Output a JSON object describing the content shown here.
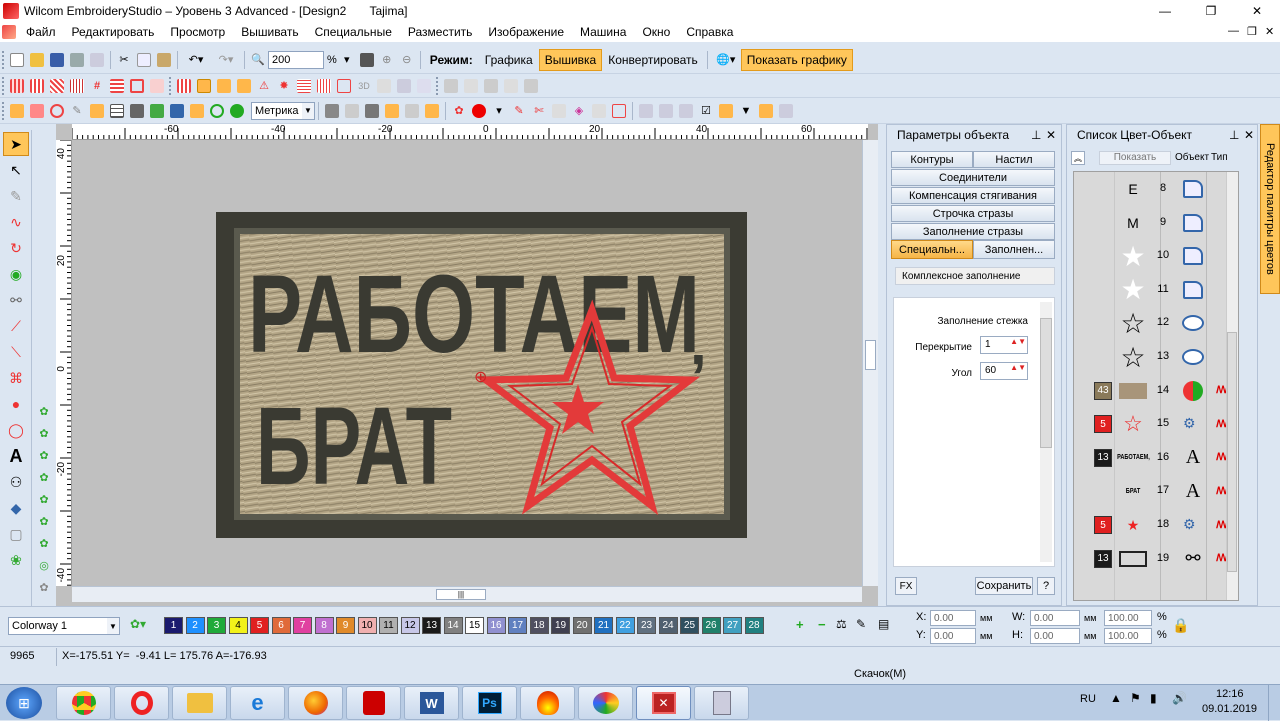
{
  "window": {
    "title": "Wilcom EmbroideryStudio – Уровень 3 Advanced - [Design2       Tajima]",
    "controls": [
      "—",
      "❐",
      "✕"
    ]
  },
  "menu": [
    "Файл",
    "Редактировать",
    "Просмотр",
    "Вышивать",
    "Специальные",
    "Разместить",
    "Изображение",
    "Машина",
    "Окно",
    "Справка"
  ],
  "toolbar1": {
    "zoom_value": "200",
    "zoom_unit": "%",
    "mode_label": "Режим:",
    "mode_graphics": "Графика",
    "mode_embroidery": "Вышивка",
    "convert": "Конвертировать",
    "show_graphics": "Показать графику"
  },
  "toolbar3": {
    "units_value": "Метрика"
  },
  "hruler_labels": [
    "-60",
    "-40",
    "-20",
    "0",
    "20",
    "40",
    "60"
  ],
  "vruler_labels": [
    "40",
    "20",
    "0",
    "-20",
    "-40"
  ],
  "design": {
    "line1": "РАБОТАЕМ",
    "comma": ",",
    "line2": "БРАТ"
  },
  "object_panel": {
    "title": "Параметры объекта",
    "tabs": {
      "contours": "Контуры",
      "fill": "Настил",
      "connectors": "Соединители",
      "pull_comp": "Компенсация стягивания",
      "rhinestone_line": "Строчка стразы",
      "rhinestone_fill": "Заполнение стразы",
      "special": "Специальн...",
      "fill2": "Заполнен..."
    },
    "section": "Комплексное заполнение",
    "field_title": "Заполнение стежка",
    "overlap_label": "Перекрытие",
    "overlap_value": "1",
    "angle_label": "Угол",
    "angle_value": "60",
    "fx": "FX",
    "save": "Сохранить",
    "help": "?"
  },
  "color_panel": {
    "title": "Список Цвет-Объект",
    "show_btn": "Показать",
    "col_object": "Объект",
    "col_type": "Тип",
    "rows": [
      {
        "num": "8",
        "swatch": "",
        "obj": "E",
        "type": "path"
      },
      {
        "num": "9",
        "swatch": "",
        "obj": "M",
        "type": "path"
      },
      {
        "num": "10",
        "swatch": "",
        "obj": "star-white",
        "type": "path"
      },
      {
        "num": "11",
        "swatch": "",
        "obj": "star-white",
        "type": "path"
      },
      {
        "num": "12",
        "swatch": "",
        "obj": "star-outline",
        "type": "bubble"
      },
      {
        "num": "13",
        "swatch": "",
        "obj": "star-outline",
        "type": "bubble"
      },
      {
        "num": "14",
        "swatch": "43",
        "obj": "rect-tan",
        "type": "complex"
      },
      {
        "num": "15",
        "swatch": "5",
        "obj": "star-red-outline",
        "type": "fill"
      },
      {
        "num": "16",
        "swatch": "13",
        "obj": "РАБОТАЕМ,",
        "type": "text"
      },
      {
        "num": "17",
        "swatch": "",
        "obj": "БРАТ",
        "type": "text"
      },
      {
        "num": "18",
        "swatch": "5",
        "obj": "star-red",
        "type": "fill"
      },
      {
        "num": "19",
        "swatch": "13",
        "obj": "rect-outline",
        "type": "satin"
      }
    ]
  },
  "side_palette": {
    "label": "Редактор палитры цветов"
  },
  "colors": {
    "accent": "#ffc65a",
    "thread_dark": "#3a3a32",
    "thread_tan": "#b8a888",
    "thread_red": "#e33a3a"
  },
  "bottom": {
    "colorway": "Colorway 1",
    "palette": [
      {
        "n": "1",
        "bg": "#1a1a6e",
        "fg": "#fff"
      },
      {
        "n": "2",
        "bg": "#1e90ff",
        "fg": "#fff"
      },
      {
        "n": "3",
        "bg": "#1faa3a",
        "fg": "#fff"
      },
      {
        "n": "4",
        "bg": "#f2f21a",
        "fg": "#000"
      },
      {
        "n": "5",
        "bg": "#e02020",
        "fg": "#fff"
      },
      {
        "n": "6",
        "bg": "#e06a3a",
        "fg": "#fff"
      },
      {
        "n": "7",
        "bg": "#e040a0",
        "fg": "#fff"
      },
      {
        "n": "8",
        "bg": "#c070d0",
        "fg": "#fff"
      },
      {
        "n": "9",
        "bg": "#e08a2a",
        "fg": "#fff"
      },
      {
        "n": "10",
        "bg": "#f0b0b0",
        "fg": "#000"
      },
      {
        "n": "11",
        "bg": "#b0b0b0",
        "fg": "#000"
      },
      {
        "n": "12",
        "bg": "#c8c8e8",
        "fg": "#000"
      },
      {
        "n": "13",
        "bg": "#1a1a1a",
        "fg": "#fff"
      },
      {
        "n": "14",
        "bg": "#808080",
        "fg": "#fff"
      },
      {
        "n": "15",
        "bg": "#ffffff",
        "fg": "#000"
      },
      {
        "n": "16",
        "bg": "#9090d0",
        "fg": "#fff"
      },
      {
        "n": "17",
        "bg": "#6080c0",
        "fg": "#fff"
      },
      {
        "n": "18",
        "bg": "#505060",
        "fg": "#fff"
      },
      {
        "n": "19",
        "bg": "#404050",
        "fg": "#fff"
      },
      {
        "n": "20",
        "bg": "#707070",
        "fg": "#fff"
      },
      {
        "n": "21",
        "bg": "#2070c0",
        "fg": "#fff"
      },
      {
        "n": "22",
        "bg": "#40a0e0",
        "fg": "#fff"
      },
      {
        "n": "23",
        "bg": "#607080",
        "fg": "#fff"
      },
      {
        "n": "24",
        "bg": "#506070",
        "fg": "#fff"
      },
      {
        "n": "25",
        "bg": "#305060",
        "fg": "#fff"
      },
      {
        "n": "26",
        "bg": "#20806a",
        "fg": "#fff"
      },
      {
        "n": "27",
        "bg": "#40a0c0",
        "fg": "#fff"
      },
      {
        "n": "28",
        "bg": "#208080",
        "fg": "#fff"
      }
    ],
    "x_label": "X:",
    "x_value": "0.00",
    "y_label": "Y:",
    "y_value": "0.00",
    "w_label": "W:",
    "w_value": "0.00",
    "h_label": "H:",
    "h_value": "0.00",
    "unit": "мм",
    "pct1": "100.00",
    "pct2": "100.00",
    "pct_unit": "%"
  },
  "status": {
    "stitches": "9965",
    "coords": "X=-175.51 Y=  -9.41 L= 175.76 A=-176.93",
    "jump": "Скачок(M)"
  },
  "taskbar": {
    "lang": "RU",
    "time": "12:16",
    "date": "09.01.2019"
  }
}
